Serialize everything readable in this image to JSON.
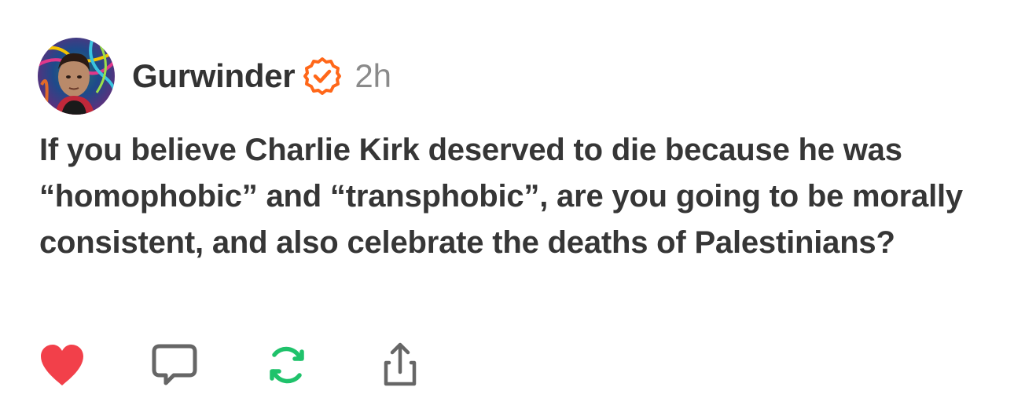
{
  "post": {
    "author": "Gurwinder",
    "verified_icon": "verified-badge-icon",
    "time": "2h",
    "text": "If you believe Charlie Kirk deserved to die because he was “homophobic” and “transphobic”, are you going to be morally consistent, and also celebrate the deaths of Palestinians?"
  },
  "actions": [
    {
      "name": "like",
      "icon": "heart-icon",
      "color": "#f2404a"
    },
    {
      "name": "comment",
      "icon": "speech-bubble-icon",
      "color": "#666666"
    },
    {
      "name": "repost",
      "icon": "repost-arrows-icon",
      "color": "#1fc26b"
    },
    {
      "name": "share",
      "icon": "share-icon",
      "color": "#666666"
    }
  ],
  "colors": {
    "verified": "#ff6719",
    "text": "#363636",
    "muted": "#8a8a8a"
  }
}
